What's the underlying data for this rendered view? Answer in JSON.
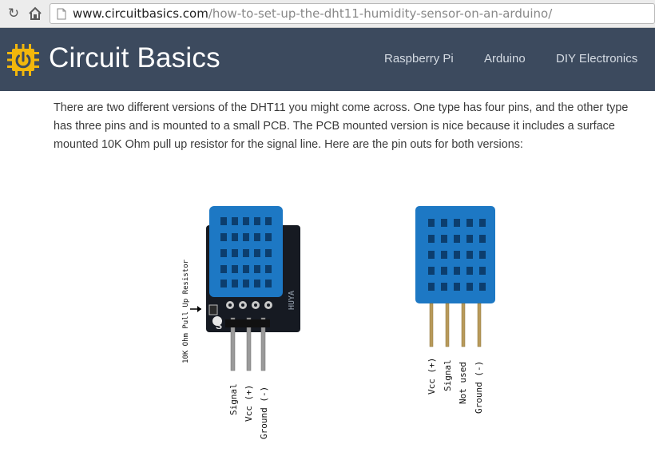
{
  "browser": {
    "url_host": "www.circuitbasics.com",
    "url_path": "/how-to-set-up-the-dht11-humidity-sensor-on-an-arduino/",
    "icons": [
      "reload-icon",
      "home-icon",
      "page-icon"
    ]
  },
  "header": {
    "logo_word1": "Circuit",
    "logo_word2": "Basics",
    "nav": [
      "Raspberry Pi",
      "Arduino",
      "DIY Electronics"
    ],
    "colors": {
      "header_bg": "#3c4a5e",
      "logo_accent": "#f2b70c",
      "sensor_blue": "#1d78c4"
    }
  },
  "content": {
    "intro": "There are two different versions of the DHT11 you might come across. One type has four pins, and the other type has three pins and is mounted to a small PCB. The PCB mounted version is nice because it includes a surface mounted 10K Ohm pull up resistor for the signal line. Here are the pin outs for both versions:"
  },
  "figure_pcb": {
    "resistor_label": "10K Ohm Pull Up Resistor",
    "pcb_marking": "HUYA",
    "pin_s": "S",
    "pins": [
      "Signal",
      "Vcc (+)",
      "Ground (-)"
    ]
  },
  "figure_4pin": {
    "pins": [
      "Vcc (+)",
      "Signal",
      "Not used",
      "Ground (-)"
    ]
  }
}
